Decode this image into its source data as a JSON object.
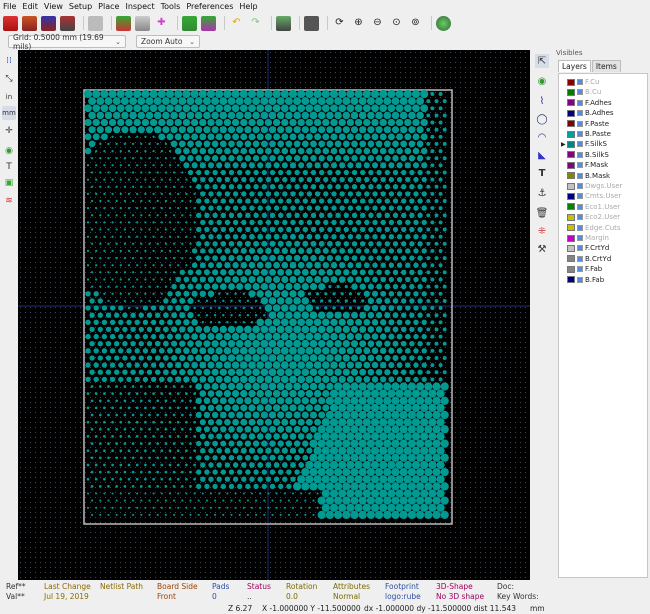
{
  "menu": [
    "File",
    "Edit",
    "View",
    "Setup",
    "Place",
    "Inspect",
    "Tools",
    "Preferences",
    "Help"
  ],
  "toolbar_icons": [
    "new-board-icon",
    "open-icon",
    "save-icon",
    "board-setup-icon",
    "page-settings-icon",
    "delete-icon",
    "netlist-icon",
    "footprint-editor-icon",
    "footprint-browser-icon",
    "add-icon",
    "update-pcb-icon",
    "route-icon",
    "undo-icon",
    "redo-icon",
    "drc-icon",
    "print-icon",
    "redraw-icon",
    "zoom-in-icon",
    "zoom-out-icon",
    "zoom-fit-icon",
    "zoom-selection-icon",
    "scripting-icon"
  ],
  "subbar": {
    "grid": "Grid: 0.5000 mm (19.69 mils)",
    "zoom": "Zoom Auto"
  },
  "left_tools": [
    "grid-toggle-icon",
    "polar-icon",
    "inches-label",
    "mm-label",
    "cursor-shape-icon",
    "ratsnest-icon",
    "text-icon",
    "zone-display-icon",
    "vias-icon"
  ],
  "left_labels": {
    "in": "in",
    "mm": "mm"
  },
  "right_tools": [
    "select-icon",
    "highlight-net-icon",
    "route-track-icon",
    "circle-icon",
    "arc-icon",
    "zone-icon",
    "text-icon",
    "anchor-icon",
    "delete-icon",
    "grid-origin-icon",
    "measure-icon"
  ],
  "panel": {
    "title": "Visibles",
    "tabs": [
      "Layers",
      "Items"
    ],
    "layers": [
      {
        "name": "F.Cu",
        "color": "#8a0000",
        "dim": true
      },
      {
        "name": "B.Cu",
        "color": "#007a00",
        "dim": true
      },
      {
        "name": "F.Adhes",
        "color": "#840084",
        "dim": false
      },
      {
        "name": "B.Adhes",
        "color": "#000084",
        "dim": false
      },
      {
        "name": "F.Paste",
        "color": "#840000",
        "dim": false
      },
      {
        "name": "B.Paste",
        "color": "#00a0a0",
        "dim": false
      },
      {
        "name": "F.SilkS",
        "color": "#008484",
        "dim": false,
        "active": true
      },
      {
        "name": "B.SilkS",
        "color": "#840084",
        "dim": false
      },
      {
        "name": "F.Mask",
        "color": "#840084",
        "dim": false
      },
      {
        "name": "B.Mask",
        "color": "#848400",
        "dim": false
      },
      {
        "name": "Dwgs.User",
        "color": "#c2c2c2",
        "dim": true
      },
      {
        "name": "Cmts.User",
        "color": "#000084",
        "dim": true
      },
      {
        "name": "Eco1.User",
        "color": "#008400",
        "dim": true
      },
      {
        "name": "Eco2.User",
        "color": "#c2c200",
        "dim": true
      },
      {
        "name": "Edge.Cuts",
        "color": "#c2c200",
        "dim": true
      },
      {
        "name": "Margin",
        "color": "#c200c2",
        "dim": true
      },
      {
        "name": "F.CrtYd",
        "color": "#c2c2c2",
        "dim": false
      },
      {
        "name": "B.CrtYd",
        "color": "#848484",
        "dim": false
      },
      {
        "name": "F.Fab",
        "color": "#848484",
        "dim": false
      },
      {
        "name": "B.Fab",
        "color": "#000084",
        "dim": false
      }
    ]
  },
  "status": {
    "cols": [
      {
        "label": "Ref**",
        "value": "Val**"
      },
      {
        "label": "Last Change",
        "value": "Jul 19, 2019"
      },
      {
        "label": "Netlist Path",
        "value": ""
      },
      {
        "label": "Board Side",
        "value": "Front"
      },
      {
        "label": "Pads",
        "value": "0"
      },
      {
        "label": "Status",
        "value": ".."
      },
      {
        "label": "Rotation",
        "value": "0.0"
      },
      {
        "label": "Attributes",
        "value": "Normal"
      },
      {
        "label": "Footprint",
        "value": "logo:rube"
      },
      {
        "label": "3D-Shape",
        "value": "No 3D shape"
      },
      {
        "label": "Doc:",
        "value": "Key Words:"
      }
    ],
    "coords": {
      "z": "Z 6.27",
      "xy": "X -1.000000  Y -11.500000",
      "dxy": "dx -1.000000  dy -11.500000  dist 11.543",
      "unit": "mm"
    }
  }
}
